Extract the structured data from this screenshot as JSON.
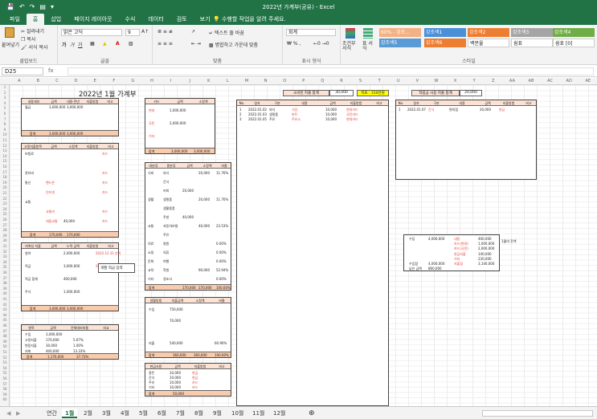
{
  "window": {
    "title": "2022년 가계부(공유) - Excel"
  },
  "ribbon_tabs": [
    "파일",
    "홈",
    "삽입",
    "페이지 레이아웃",
    "수식",
    "데이터",
    "검토",
    "보기"
  ],
  "tell_me": "수행할 작업을 알려 주세요.",
  "clipboard": {
    "paste": "붙여넣기",
    "cut": "잘라내기",
    "copy": "복사",
    "format_painter": "서식 복사",
    "label": "클립보드"
  },
  "font": {
    "name": "맑은 고딕",
    "size": "9",
    "bold": "가",
    "italic": "가",
    "underline": "가",
    "label": "글꼴"
  },
  "alignment": {
    "wrap": "텍스트 줄 바꿈",
    "merge": "병합하고 가운데 맞춤",
    "label": "맞춤"
  },
  "number": {
    "format": "회계",
    "label": "표시 형식"
  },
  "styles": {
    "conditional": "조건부 서식",
    "table": "표 서식",
    "cells": [
      {
        "name": "60% - 강조...",
        "color": "#f4b183"
      },
      {
        "name": "강조색1",
        "color": "#4a90d9"
      },
      {
        "name": "강조색2",
        "color": "#ed7d31"
      },
      {
        "name": "강조색3",
        "color": "#a5a5a5"
      },
      {
        "name": "강조색4",
        "color": "#70ad47"
      },
      {
        "name": "강조색5",
        "color": "#5b9bd5"
      },
      {
        "name": "강조색6",
        "color": "#ed7d31"
      },
      {
        "name": "백분율",
        "color": "#ffffff"
      },
      {
        "name": "쉼표",
        "color": "#ffffff"
      },
      {
        "name": "쉼표 [0]",
        "color": "#ffffff"
      }
    ],
    "label": "스타일"
  },
  "formula_bar": {
    "name_box": "D25",
    "fx": "fx",
    "content": ""
  },
  "columns": [
    "A",
    "B",
    "C",
    "D",
    "E",
    "F",
    "G",
    "H",
    "I",
    "J",
    "K",
    "L",
    "M",
    "N",
    "O",
    "P",
    "Q",
    "R",
    "S",
    "T",
    "U",
    "V",
    "W",
    "X",
    "Y",
    "Z",
    "AA",
    "AB",
    "AC",
    "AD",
    "AE"
  ],
  "sheet": {
    "title": "2022년 1월 가계부",
    "income": {
      "headers": [
        "내용세부",
        "금액",
        "내용·전년",
        "지출방법",
        "비고"
      ],
      "rows": [
        [
          "월급",
          "3,000,000",
          "3,000,000",
          "",
          ""
        ]
      ],
      "total_label": "합계",
      "total": "3,000,000"
    },
    "fixed": {
      "headers": [
        "고정지출항목",
        "금액",
        "소정액",
        "지출방법",
        "비고"
      ],
      "rows": [
        [
          "보험료",
          "",
          "",
          "",
          "카드"
        ],
        [
          "",
          "",
          "",
          "",
          ""
        ],
        [
          "관리비",
          "",
          "",
          "",
          "카드"
        ],
        [
          "통신",
          "핸드폰",
          "",
          "",
          "카드"
        ],
        [
          "",
          "인터넷",
          "",
          "",
          "카드"
        ],
        [
          "교통",
          "",
          "",
          "",
          ""
        ],
        [
          "",
          "교통비",
          "",
          "",
          "카드"
        ],
        [
          "",
          "대중교통",
          "40,000",
          "",
          "카드"
        ]
      ],
      "total_label": "합계",
      "total": "170,000"
    },
    "savings": {
      "headers": [
        "저축성 지출",
        "금액",
        "누적 금액",
        "지출방법",
        "비고"
      ],
      "rows": [
        [
          "청약",
          "",
          "2,000,000",
          "",
          "2022.12.31 만기"
        ],
        [
          "적금",
          "",
          "3,000,000",
          "",
          "2022.12.31 만기"
        ],
        [
          "적금 합계",
          "",
          "400,000",
          "",
          ""
        ],
        [
          "주식",
          "",
          "1,000,000",
          "",
          ""
        ]
      ],
      "memo": "개월 적금 입력",
      "total_label": "합계",
      "total": "3,000,000"
    },
    "summary": {
      "headers": [
        "항목",
        "금액",
        "전체대비비율",
        "비교"
      ],
      "rows": [
        [
          "수입",
          "3,000,000",
          "",
          ""
        ],
        [
          "고정지출",
          "170,000",
          "5.67%",
          ""
        ],
        [
          "변동지출",
          "30,000",
          "1.00%",
          ""
        ],
        [
          "저축",
          "400,000",
          "13.33%",
          ""
        ]
      ],
      "total_label": "합계",
      "total": "1,170,000",
      "ratio": "37.73%"
    },
    "cards": {
      "headers": [
        "카드",
        "금액",
        "소정액"
      ],
      "rows": [
        [
          "현대",
          "1,000,000",
          ""
        ],
        [
          "국민",
          "2,000,000",
          ""
        ],
        [
          "기타",
          "",
          ""
        ]
      ],
      "total_label": "합계",
      "total": "3,000,000"
    },
    "variable": {
      "headers": [
        "대분류",
        "중분류",
        "금액",
        "소정액",
        "비율"
      ],
      "rows": [
        [
          "식비",
          "외식",
          "",
          "20,000",
          "11.76%"
        ],
        [
          "",
          "간식",
          "",
          "",
          ""
        ],
        [
          "",
          "커피",
          "20,000",
          "",
          ""
        ],
        [
          "생활",
          "생필품",
          "",
          "20,000",
          "11.76%"
        ],
        [
          "",
          "생활용품",
          "",
          "",
          ""
        ],
        [
          "",
          "주방",
          "40,000",
          "",
          ""
        ],
        [
          "교통",
          "자동차보험",
          "",
          "40,000",
          "23.53%"
        ],
        [
          "",
          "주유",
          "",
          "",
          ""
        ],
        [
          "의료",
          "병원",
          "",
          "",
          "0.00%"
        ],
        [
          "쇼핑",
          "의류",
          "",
          "",
          "0.00%"
        ],
        [
          "문화",
          "여행",
          "",
          "",
          "0.00%"
        ],
        [
          "교육",
          "학원",
          "",
          "90,000",
          "52.94%"
        ],
        [
          "기타",
          "경조사",
          "",
          "",
          "0.00%"
        ]
      ],
      "total_label": "합계",
      "total": "170,000",
      "ratio": "100.00%"
    },
    "living": {
      "headers": [
        "생활방법",
        "지출금액",
        "소정액",
        "비율"
      ],
      "rows": [
        [
          "수입",
          "750,000",
          "",
          ""
        ],
        [
          "",
          "70,000",
          "",
          ""
        ],
        [
          "",
          "",
          "",
          ""
        ],
        [
          "지출",
          "540,000",
          "",
          "60.90%"
        ]
      ],
      "total_label": "합계",
      "total": "360,000",
      "ratio": "100.00%"
    },
    "cash": {
      "headers": [
        "현금사용",
        "금액",
        "지출방법",
        "비고"
      ],
      "rows": [
        [
          "용돈",
          "10,000",
          "현금",
          ""
        ],
        [
          "간식",
          "10,000",
          "현금",
          ""
        ],
        [
          "주유",
          "10,000",
          "카드",
          ""
        ],
        [
          "기타",
          "10,000",
          "카드",
          ""
        ]
      ],
      "total_label": "합계",
      "total": "50,000"
    },
    "card_ledger": {
      "title": "소비된 지출 합계",
      "amount": "30,000",
      "remaining_label": "목표 : 150만원",
      "headers": [
        "No.",
        "일자",
        "구분",
        "내용",
        "금액",
        "지출방법",
        "비고"
      ],
      "rows": [
        [
          "1",
          "2022.01.02",
          "외식",
          "식당",
          "10,000",
          "현대카드",
          ""
        ],
        [
          "2",
          "2022.01.03",
          "생필품",
          "마트",
          "10,000",
          "국민카드",
          ""
        ],
        [
          "3",
          "2022.01.05",
          "주유",
          "주유소",
          "10,000",
          "현대카드",
          ""
        ]
      ]
    },
    "cash_ledger": {
      "title": "적립금 사용 지출 합계",
      "amount": "20,000",
      "headers": [
        "No.",
        "일자",
        "구분",
        "내용",
        "금액",
        "지출방법",
        "비고"
      ],
      "rows": [
        [
          "1",
          "2022.01.07",
          "간식",
          "편의점",
          "20,000",
          "현금",
          ""
        ]
      ]
    },
    "balance": {
      "rows": [
        [
          "수입",
          "4,000,000",
          "내용",
          "400,000"
        ],
        [
          "",
          "",
          "카드(현대)",
          "1,000,000"
        ],
        [
          "",
          "",
          "카드(국민)",
          "2,000,000"
        ],
        [
          "",
          "",
          "현금지출",
          "140,000"
        ],
        [
          "",
          "",
          "기타",
          "230,000"
        ],
        [
          "수입합",
          "4,000,000",
          "지출합",
          "3,140,000"
        ],
        [
          "남은 금액",
          "860,000",
          "",
          ""
        ]
      ],
      "note": "1월의 잔액"
    }
  },
  "sheet_tabs": [
    "연간",
    "1월",
    "2월",
    "3월",
    "4월",
    "5월",
    "6월",
    "7월",
    "8월",
    "9월",
    "10월",
    "11월",
    "12월"
  ],
  "active_tab": "1월"
}
